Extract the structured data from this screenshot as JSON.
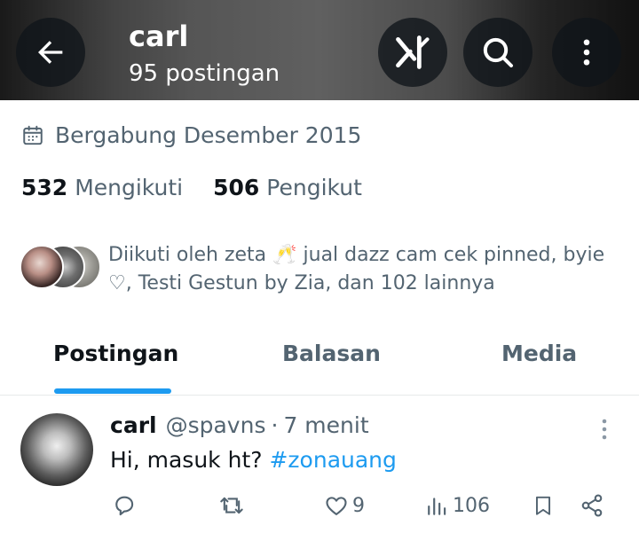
{
  "header": {
    "title": "carl",
    "post_count": "95 postingan",
    "icons": [
      "back-arrow-icon",
      "grok-icon",
      "search-icon",
      "more-vertical-icon"
    ]
  },
  "profile": {
    "joined": "Bergabung Desember 2015",
    "following_count": "532",
    "following_label": "Mengikuti",
    "followers_count": "506",
    "followers_label": "Pengikut",
    "followed_by": "Diikuti oleh zeta 🥂 jual dazz cam cek pinned, byie ♡, Testi Gestun by Zia, dan 102 lainnya"
  },
  "tabs": [
    {
      "label": "Postingan",
      "active": true
    },
    {
      "label": "Balasan",
      "active": false
    },
    {
      "label": "Media",
      "active": false
    }
  ],
  "post": {
    "name": "carl",
    "handle": "@spavns",
    "separator": "·",
    "time": "7 menit",
    "text": "Hi, masuk ht?",
    "hashtag": "#zonauang",
    "likes": "9",
    "views": "106"
  },
  "colors": {
    "accent": "#1d9bf0",
    "text_primary": "#0f1419",
    "text_secondary": "#536471",
    "divider": "#e7e9ea"
  }
}
